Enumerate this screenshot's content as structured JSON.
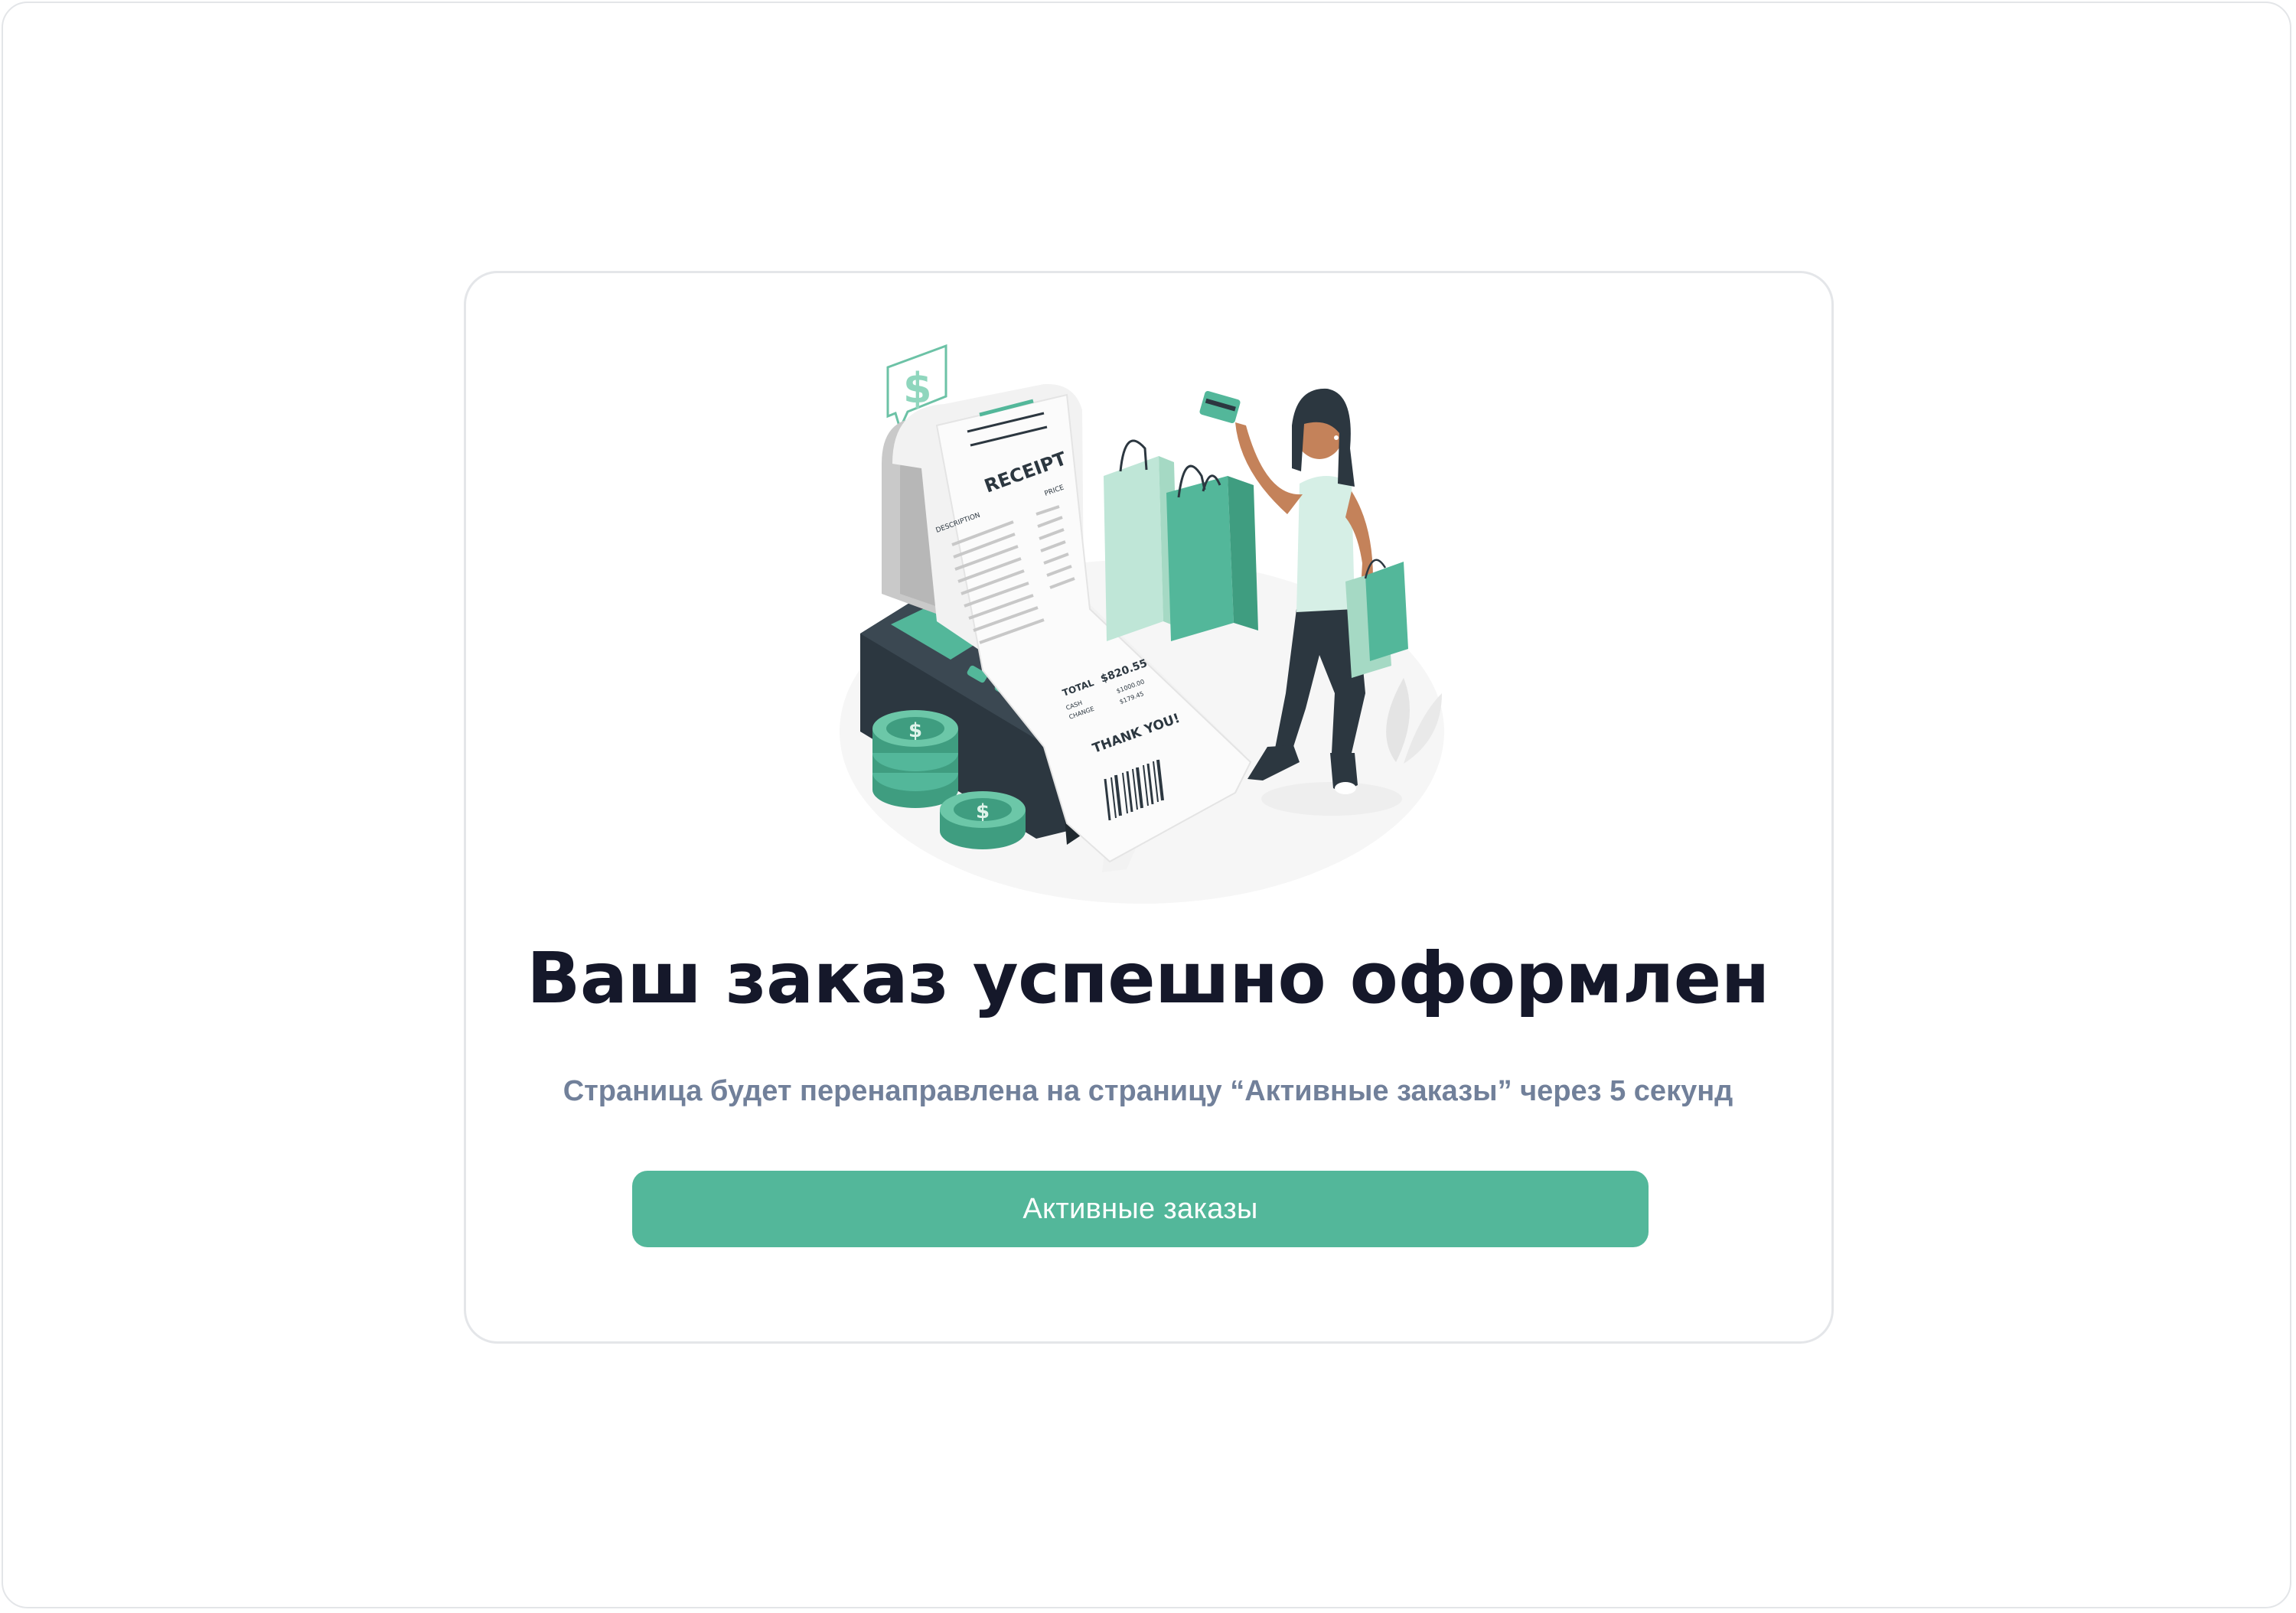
{
  "confirmation": {
    "title": "Ваш заказ успешно оформлен",
    "subtitle": "Страница будет перенаправлена на страницу “Активные заказы” через 5 секунд",
    "button_label": "Активные заказы"
  },
  "illustration": {
    "receipt_title": "RECEIPT",
    "col_description": "DESCRIPTION",
    "col_price": "PRICE",
    "total_label": "TOTAL",
    "total_value": "$820.55",
    "cash_label": "CASH",
    "cash_value": "$1000.00",
    "change_label": "CHANGE",
    "change_value": "$179.45",
    "thanks": "THANK YOU!",
    "currency_symbol": "$"
  },
  "colors": {
    "accent": "#53b79a",
    "title": "#15182a",
    "subtitle": "#71809a"
  }
}
